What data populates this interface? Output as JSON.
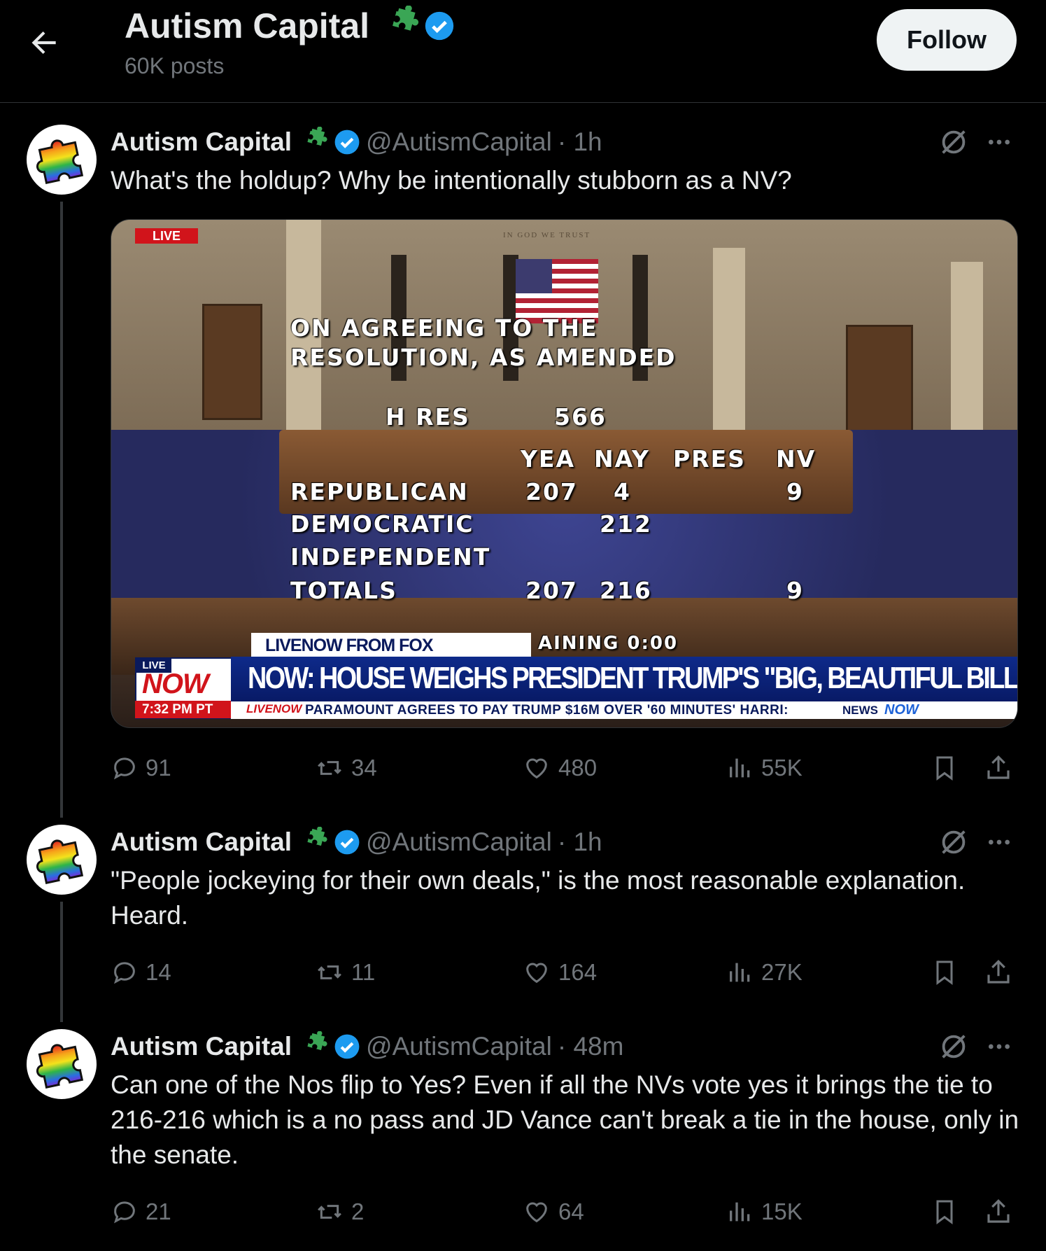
{
  "header": {
    "title": "Autism Capital",
    "posts_count": "60K posts",
    "follow_label": "Follow"
  },
  "tweets": [
    {
      "name": "Autism Capital",
      "handle": "@AutismCapital",
      "time": "· 1h",
      "text": "What's the holdup? Why be intentionally stubborn as a NV?",
      "replies": "91",
      "retweets": "34",
      "likes": "480",
      "views": "55K"
    },
    {
      "name": "Autism Capital",
      "handle": "@AutismCapital",
      "time": "· 1h",
      "text": "\"People jockeying for their own deals,\" is the most reasonable explanation. Heard.",
      "replies": "14",
      "retweets": "11",
      "likes": "164",
      "views": "27K"
    },
    {
      "name": "Autism Capital",
      "handle": "@AutismCapital",
      "time": "· 48m",
      "text": "Can one of the Nos flip to Yes? Even if all the NVs vote yes it brings the tie to 216-216 which is a no pass and JD Vance can't break a tie in the house, only in the senate.",
      "replies": "21",
      "retweets": "2",
      "likes": "64",
      "views": "15K"
    }
  ],
  "media": {
    "live_tag": "LIVE",
    "motto": "IN GOD WE TRUST",
    "heading_1": "ON AGREEING TO THE",
    "heading_2": "RESOLUTION, AS AMENDED",
    "bill_prefix": "H RES",
    "bill_number": "566",
    "col_yea": "YEA",
    "col_nay": "NAY",
    "col_pres": "PRES",
    "col_nv": "NV",
    "rows": [
      {
        "party": "REPUBLICAN",
        "yea": "207",
        "nay": "4",
        "pres": "",
        "nv": "9"
      },
      {
        "party": "DEMOCRATIC",
        "yea": "",
        "nay": "212",
        "pres": "",
        "nv": ""
      },
      {
        "party": "INDEPENDENT",
        "yea": "",
        "nay": "",
        "pres": "",
        "nv": ""
      },
      {
        "party": "TOTALS",
        "yea": "207",
        "nay": "216",
        "pres": "",
        "nv": "9"
      }
    ],
    "remaining": "AINING 0:00",
    "source_label": "LIVENOW FROM FOX",
    "badge_live": "LIVE",
    "badge_now": "NOW",
    "badge_time": "7:32 PM PT",
    "headline": "NOW: HOUSE WEIGHS PRESIDENT TRUMP'S \"BIG, BEAUTIFUL BILL\"",
    "ticker_logo": "LIVENOW",
    "ticker": "PARAMOUNT AGREES TO PAY TRUMP $16M OVER '60 MINUTES' HARRI:",
    "ticker_news": "NEWS",
    "ticker_now": "NOW"
  },
  "colors": {
    "verified": "#1d9bf0",
    "puzzle_green": "#3aa655",
    "muted": "#71767b"
  }
}
